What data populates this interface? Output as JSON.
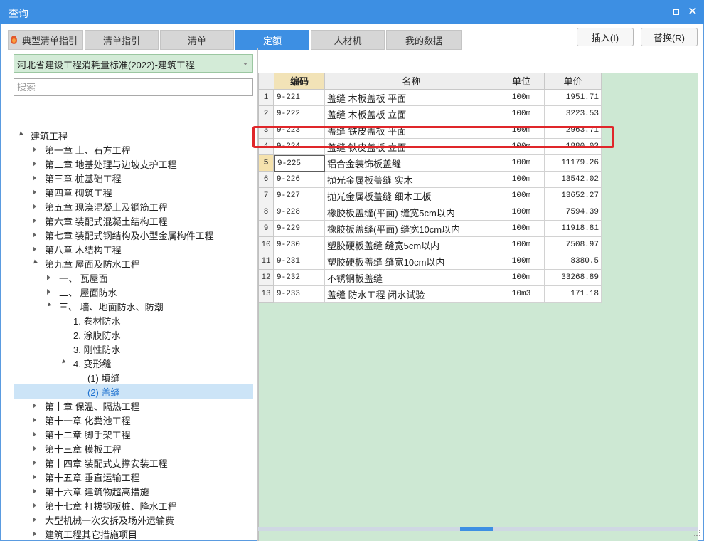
{
  "window": {
    "title": "查询"
  },
  "tabs": [
    {
      "label": "典型清单指引"
    },
    {
      "label": "清单指引"
    },
    {
      "label": "清单"
    },
    {
      "label": "定额"
    },
    {
      "label": "人材机"
    },
    {
      "label": "我的数据"
    }
  ],
  "active_tab": "定额",
  "actions": {
    "insert_label": "插入(I)",
    "replace_label": "替换(R)"
  },
  "library_select": {
    "value": "河北省建设工程消耗量标准(2022)-建筑工程"
  },
  "search": {
    "placeholder": "搜索"
  },
  "tree": [
    {
      "label": "建筑工程",
      "level": 0,
      "state": "open"
    },
    {
      "label": "第一章 土、石方工程",
      "level": 1,
      "state": "closed"
    },
    {
      "label": "第二章 地基处理与边坡支护工程",
      "level": 1,
      "state": "closed"
    },
    {
      "label": "第三章 桩基础工程",
      "level": 1,
      "state": "closed"
    },
    {
      "label": "第四章 砌筑工程",
      "level": 1,
      "state": "closed"
    },
    {
      "label": "第五章 现浇混凝土及钢筋工程",
      "level": 1,
      "state": "closed"
    },
    {
      "label": "第六章 装配式混凝土结构工程",
      "level": 1,
      "state": "closed"
    },
    {
      "label": "第七章 装配式钢结构及小型金属构件工程",
      "level": 1,
      "state": "closed"
    },
    {
      "label": "第八章 木结构工程",
      "level": 1,
      "state": "closed"
    },
    {
      "label": "第九章 屋面及防水工程",
      "level": 1,
      "state": "open"
    },
    {
      "label": "一、 瓦屋面",
      "level": 2,
      "state": "closed"
    },
    {
      "label": "二、 屋面防水",
      "level": 2,
      "state": "closed"
    },
    {
      "label": "三、 墙、地面防水、防潮",
      "level": 2,
      "state": "open"
    },
    {
      "label": "1. 卷材防水",
      "level": 3,
      "state": "leaf"
    },
    {
      "label": "2. 涂膜防水",
      "level": 3,
      "state": "leaf"
    },
    {
      "label": "3. 刚性防水",
      "level": 3,
      "state": "leaf"
    },
    {
      "label": "4. 变形缝",
      "level": 3,
      "state": "open"
    },
    {
      "label": "(1) 填缝",
      "level": 4,
      "state": "leaf"
    },
    {
      "label": "(2) 盖缝",
      "level": 4,
      "state": "leaf",
      "selected": true
    },
    {
      "label": "第十章 保温、隔热工程",
      "level": 1,
      "state": "closed"
    },
    {
      "label": "第十一章 化粪池工程",
      "level": 1,
      "state": "closed"
    },
    {
      "label": "第十二章 脚手架工程",
      "level": 1,
      "state": "closed"
    },
    {
      "label": "第十三章 模板工程",
      "level": 1,
      "state": "closed"
    },
    {
      "label": "第十四章 装配式支撑安装工程",
      "level": 1,
      "state": "closed"
    },
    {
      "label": "第十五章 垂直运输工程",
      "level": 1,
      "state": "closed"
    },
    {
      "label": "第十六章 建筑物超高措施",
      "level": 1,
      "state": "closed"
    },
    {
      "label": "第十七章 打拔钢板桩、降水工程",
      "level": 1,
      "state": "closed"
    },
    {
      "label": "大型机械一次安拆及场外运输费",
      "level": 1,
      "state": "closed"
    },
    {
      "label": "建筑工程其它措施项目",
      "level": 1,
      "state": "closed"
    }
  ],
  "table": {
    "headers": {
      "code": "编码",
      "name": "名称",
      "unit": "单位",
      "price": "单价"
    },
    "selected_row": 5,
    "rows": [
      {
        "num": "1",
        "code": "9-221",
        "name": "盖缝 木板盖板 平面",
        "unit": "100m",
        "price": "1951.71"
      },
      {
        "num": "2",
        "code": "9-222",
        "name": "盖缝 木板盖板 立面",
        "unit": "100m",
        "price": "3223.53"
      },
      {
        "num": "3",
        "code": "9-223",
        "name": "盖缝 铁皮盖板 平面",
        "unit": "100m",
        "price": "2963.71"
      },
      {
        "num": "4",
        "code": "9-224",
        "name": "盖缝 铁皮盖板 立面",
        "unit": "100m",
        "price": "1880.03"
      },
      {
        "num": "5",
        "code": "9-225",
        "name": "铝合金装饰板盖缝",
        "unit": "100m",
        "price": "11179.26"
      },
      {
        "num": "6",
        "code": "9-226",
        "name": "抛光金属板盖缝 实木",
        "unit": "100m",
        "price": "13542.02"
      },
      {
        "num": "7",
        "code": "9-227",
        "name": "抛光金属板盖缝 细木工板",
        "unit": "100m",
        "price": "13652.27"
      },
      {
        "num": "8",
        "code": "9-228",
        "name": "橡胶板盖缝(平面) 缝宽5cm以内",
        "unit": "100m",
        "price": "7594.39"
      },
      {
        "num": "9",
        "code": "9-229",
        "name": "橡胶板盖缝(平面) 缝宽10cm以内",
        "unit": "100m",
        "price": "11918.81"
      },
      {
        "num": "10",
        "code": "9-230",
        "name": "塑胶硬板盖缝 缝宽5cm以内",
        "unit": "100m",
        "price": "7508.97"
      },
      {
        "num": "11",
        "code": "9-231",
        "name": "塑胶硬板盖缝 缝宽10cm以内",
        "unit": "100m",
        "price": "8380.5"
      },
      {
        "num": "12",
        "code": "9-232",
        "name": "不锈钢板盖缝",
        "unit": "100m",
        "price": "33268.89"
      },
      {
        "num": "13",
        "code": "9-233",
        "name": "盖缝 防水工程 闭水试验",
        "unit": "10m3",
        "price": "171.18"
      }
    ]
  },
  "colors": {
    "title_bar": "#3d8fe3",
    "active_tab": "#3d8fe3",
    "grid_background": "#cde8d3",
    "highlight_box": "#e0262a",
    "tree_selection": "#cce4f7"
  },
  "icons": [
    "flame-icon",
    "maximize-icon",
    "close-icon",
    "dropdown-arrow-icon",
    "expand-arrow-icon",
    "collapse-arrow-icon"
  ]
}
